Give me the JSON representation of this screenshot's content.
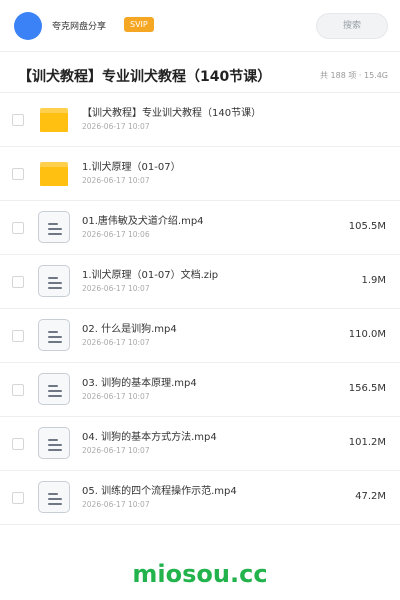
{
  "header": {
    "app_name": "夸克网盘分享",
    "badge": "SVIP",
    "search_placeholder": "搜索",
    "avatar_color": "#3b82f6"
  },
  "page": {
    "title": "【训犬教程】专业训犬教程（140节课）",
    "meta": "共 188 项 · 15.4G"
  },
  "files": [
    {
      "type": "folder",
      "icon": "folder-icon",
      "name": "【训犬教程】专业训犬教程（140节课）",
      "date": "2026-06-17 10:07",
      "size": ""
    },
    {
      "type": "folder",
      "icon": "folder-icon",
      "name": "1.训犬原理（01-07）",
      "date": "2026-06-17 10:07",
      "size": ""
    },
    {
      "type": "file",
      "icon": "document-icon",
      "name": "01.唐伟敏及犬道介绍.mp4",
      "date": "2026-06-17 10:06",
      "size": "105.5M"
    },
    {
      "type": "file",
      "icon": "document-icon",
      "name": "1.训犬原理（01-07）文档.zip",
      "date": "2026-06-17 10:07",
      "size": "1.9M"
    },
    {
      "type": "file",
      "icon": "document-icon",
      "name": "02. 什么是训狗.mp4",
      "date": "2026-06-17 10:07",
      "size": "110.0M"
    },
    {
      "type": "file",
      "icon": "document-icon",
      "name": "03. 训狗的基本原理.mp4",
      "date": "2026-06-17 10:07",
      "size": "156.5M"
    },
    {
      "type": "file",
      "icon": "document-icon",
      "name": "04. 训狗的基本方式方法.mp4",
      "date": "2026-06-17 10:07",
      "size": "101.2M"
    },
    {
      "type": "file",
      "icon": "document-icon",
      "name": "05. 训练的四个流程操作示范.mp4",
      "date": "2026-06-17 10:07",
      "size": "47.2M"
    }
  ],
  "footer": {
    "watermark": "miosou.cc",
    "watermark_color": "#22b34c"
  },
  "colors": {
    "badge": "#f5a623",
    "folder": "#ffc012"
  }
}
